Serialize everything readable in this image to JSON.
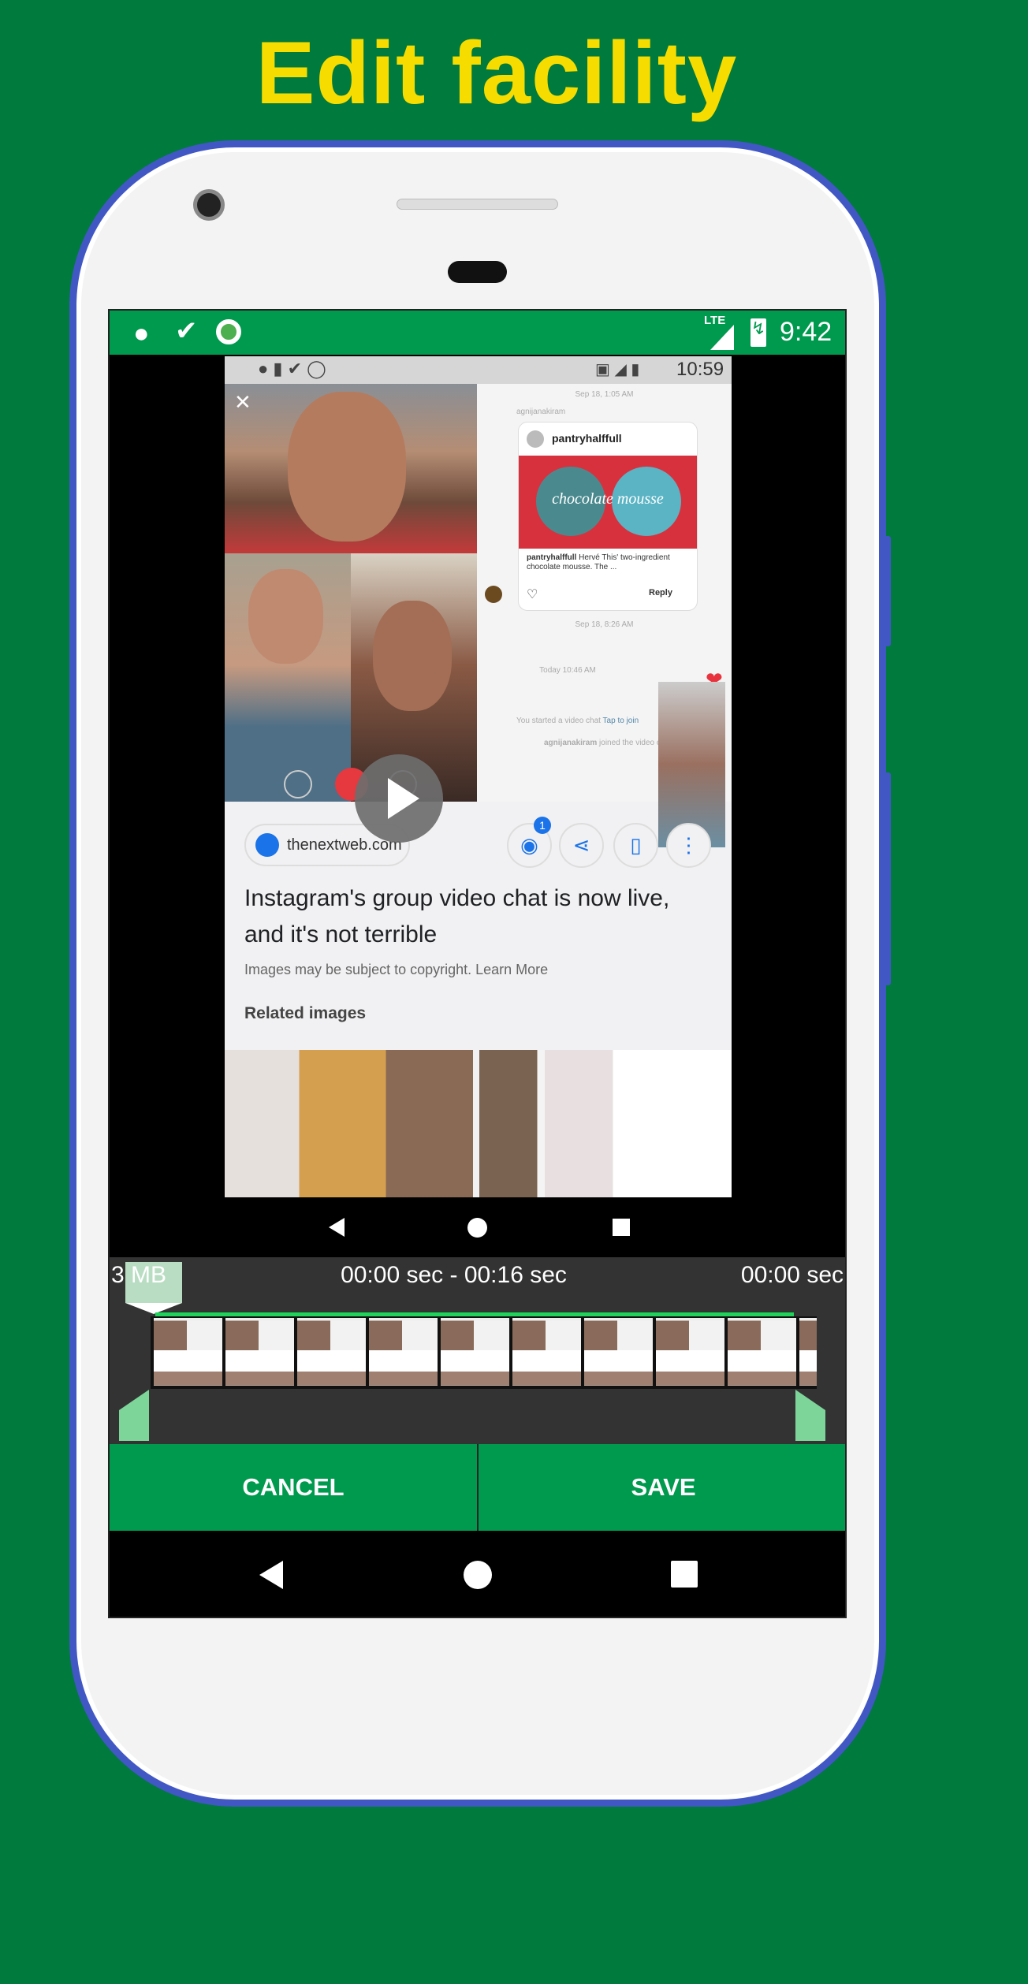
{
  "banner": {
    "title": "Edit facility"
  },
  "status_bar": {
    "icons": [
      "keyhole-icon",
      "download-done-icon",
      "record-icon"
    ],
    "network": "LTE",
    "time": "9:42"
  },
  "video": {
    "inner_status_time": "10:59",
    "chat": {
      "date1": "Sep 18, 1:05 AM",
      "sender": "agnijanakiram",
      "post_user": "pantryhalffull",
      "post_image_text": "chocolate mousse",
      "caption_user": "pantryhalffull",
      "caption": "Hervé This' two-ingredient chocolate mousse. The ...",
      "reply": "Reply",
      "date2": "Sep 18, 8:26 AM",
      "date3": "Today 10:46 AM",
      "started": "You started a video chat",
      "tap": "Tap to join",
      "joined_user": "agnijanakiram",
      "joined": "joined the video chat"
    },
    "page": {
      "source": "thenextweb.com",
      "badge": "1",
      "headline": "Instagram's group video chat is now live, and it's not terrible",
      "copyright": "Images may be subject to copyright. Learn More",
      "related": "Related images"
    }
  },
  "timeline": {
    "size": "3 MB",
    "range": "00:00 sec - 00:16 sec",
    "position": "00:00 sec",
    "thumbnail_count": 10,
    "accent": "#1fd35a"
  },
  "actions": {
    "cancel": "CANCEL",
    "save": "SAVE"
  },
  "colors": {
    "background": "#007a3d",
    "title": "#f7dc00",
    "phone_border": "#4157c4",
    "app_green": "#009a4e",
    "panel": "#333333"
  }
}
